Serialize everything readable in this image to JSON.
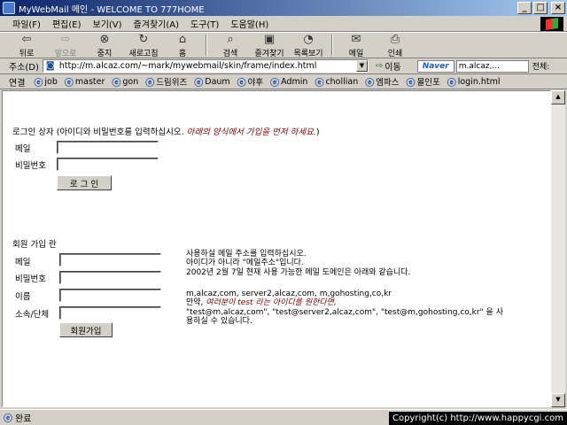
{
  "window": {
    "title": "MyWebMail 메인 - WELCOME TO 777HOME",
    "buttons": {
      "minimize": "_",
      "maximize": "□",
      "close": "×"
    }
  },
  "menu": [
    "파일(F)",
    "편집(E)",
    "보기(V)",
    "즐겨찾기(A)",
    "도구(T)",
    "도움말(H)"
  ],
  "toolbar": {
    "back": "뒤로",
    "forward": "앞으로",
    "stop": "중지",
    "refresh": "새로고침",
    "home": "홈",
    "search": "검색",
    "favorites": "즐겨찾기",
    "history": "목록보기",
    "mail": "메일",
    "print": "인쇄"
  },
  "address": {
    "label": "주소(D)",
    "url": "http://m.alcaz.com/~mark/mywebmail/skin/frame/index.html",
    "go": "이동",
    "search_brand": "Naver",
    "search_value": "m.alcaz,...",
    "search_scope": "전체:"
  },
  "links": {
    "label": "연결",
    "items": [
      "job",
      "master",
      "gon",
      "드림위즈",
      "Daum",
      "야후",
      "Admin",
      "chollian",
      "엠파스",
      "몰인포",
      "login.html"
    ]
  },
  "login": {
    "title": "로그인 상자 (아이디와 비밀번호를 입력하십시오. ",
    "warning": "아래의 양식에서 가입을 먼저 하세요.",
    "title_end": ")",
    "email_label": "메일",
    "password_label": "비밀번호",
    "email_value": "",
    "password_value": "",
    "button": "로 그 인"
  },
  "signup": {
    "title": "회원 가입 란",
    "email_label": "메일",
    "password_label": "비밀번호",
    "name_label": "이름",
    "org_label": "소속/단체",
    "button": "회원가입",
    "help_line1": "사용하실 메일 주소를 입력하십시오.",
    "help_line2": "아이디가 아니라 \"메일주소\"입니다.",
    "help_line3": "2002년 2월 7일 현재 사용 가능한 메일 도메인은 아래와 같습니다.",
    "domains": "m,alcaz,com, server2,alcaz,com, m,gohosting,co,kr",
    "note_prefix": "만약, ",
    "note_warn": "여러분이 test 라는 아이디를 원한다면,",
    "examples": "\"test@m,alcaz,com\", \"test@server2,alcaz,com\", \"test@m,gohosting,co,kr\" 을 사",
    "examples_end": "용하실 수 있습니다."
  },
  "status": {
    "text": "완료",
    "copyright": "Copyright(c) http://www.happycgi.com"
  }
}
